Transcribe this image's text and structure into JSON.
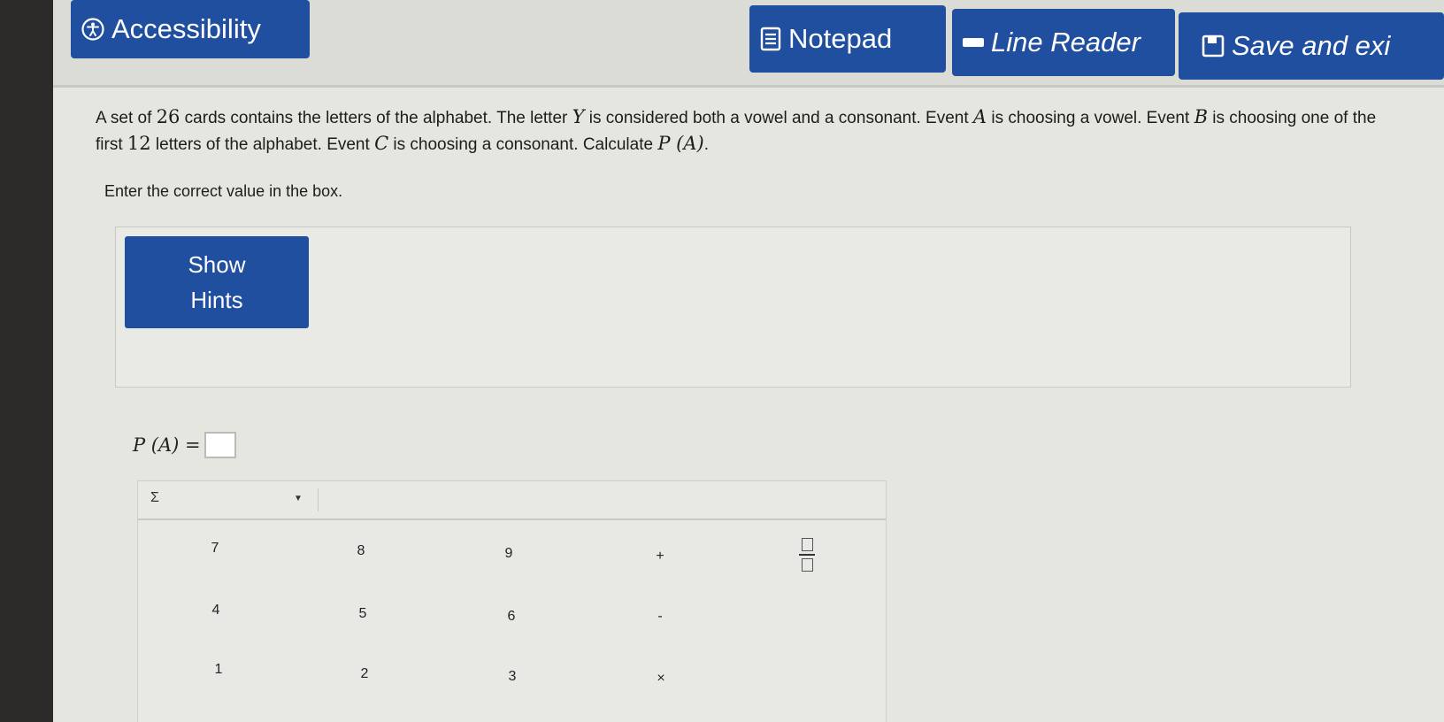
{
  "toolbar": {
    "accessibility": "Accessibility",
    "notepad": "Notepad",
    "line_reader": "Line Reader",
    "save_exit": "Save and exi"
  },
  "question": {
    "t1": "A set of ",
    "n26": "26",
    "t2": " cards contains the letters of the alphabet. The letter ",
    "Y": "Y",
    "t3": " is considered both a vowel and a consonant. Event ",
    "A1": "A",
    "t4": " is choosing a vowel. Event ",
    "B": "B",
    "t5": " is choosing one of the first ",
    "n12": "12",
    "t6": " letters of the alphabet. Event ",
    "C": "C",
    "t7": " is choosing a consonant. Calculate ",
    "PA": "P (A)",
    "t8": "."
  },
  "instruction": "Enter the correct value in the box.",
  "hints": {
    "line1": "Show",
    "line2": "Hints"
  },
  "answer": {
    "label": "P (A) =",
    "value": ""
  },
  "keypad": {
    "dropdown_symbol": "Σ",
    "keys": {
      "k7": "7",
      "k8": "8",
      "k9": "9",
      "plus": "+",
      "k4": "4",
      "k5": "5",
      "k6": "6",
      "minus": "-",
      "k1": "1",
      "k2": "2",
      "k3": "3",
      "times": "×"
    }
  },
  "colors": {
    "accent": "#1f4f9e",
    "background": "#e6e6e1"
  },
  "icons": [
    "accessibility-icon",
    "notepad-icon",
    "line-reader-icon",
    "save-icon",
    "fraction-icon",
    "chevron-down-icon"
  ]
}
